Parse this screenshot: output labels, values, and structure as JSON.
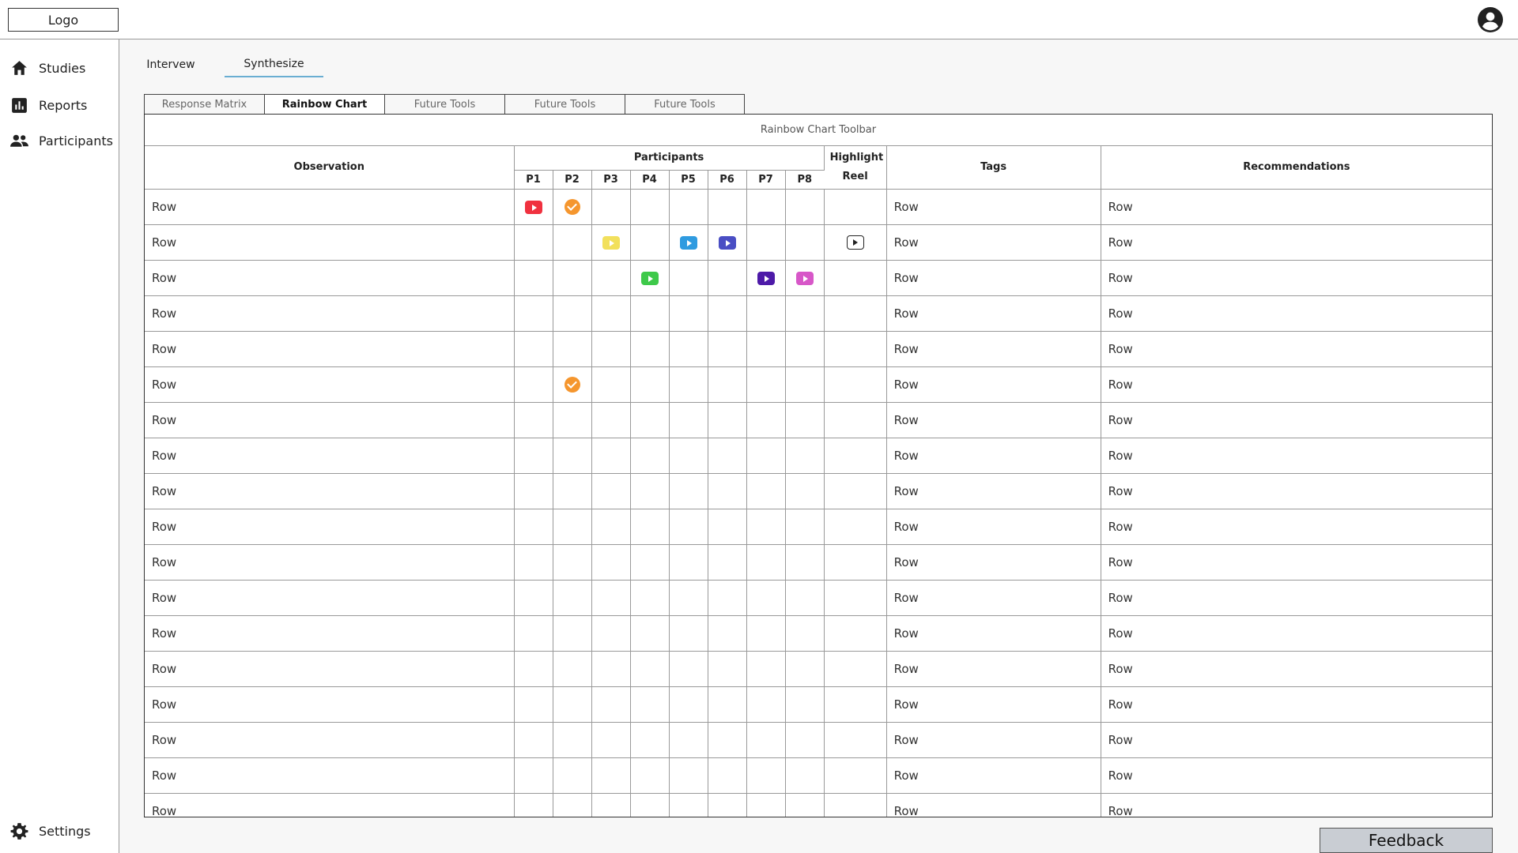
{
  "header": {
    "logo": "Logo",
    "account_icon": "account-circle-icon"
  },
  "sidebar": {
    "items": [
      {
        "label": "Studies",
        "icon": "home-icon"
      },
      {
        "label": "Reports",
        "icon": "bar-chart-icon"
      },
      {
        "label": "Participants",
        "icon": "people-icon"
      }
    ],
    "settings": {
      "label": "Settings",
      "icon": "gear-icon"
    }
  },
  "page_tabs": [
    {
      "label": "Intervew",
      "active": false
    },
    {
      "label": "Synthesize",
      "active": true
    }
  ],
  "tool_tabs": [
    {
      "label": "Response Matrix",
      "active": false
    },
    {
      "label": "Rainbow Chart",
      "active": true
    },
    {
      "label": "Future Tools",
      "active": false
    },
    {
      "label": "Future Tools",
      "active": false
    },
    {
      "label": "Future Tools",
      "active": false
    }
  ],
  "toolbar_label": "Rainbow Chart Toolbar",
  "table": {
    "columns": {
      "observation": "Observation",
      "participants": "Participants",
      "highlight_reel": "Highlight Reel",
      "tags": "Tags",
      "recommendations": "Recommendations"
    },
    "participant_ids": [
      "P1",
      "P2",
      "P3",
      "P4",
      "P5",
      "P6",
      "P7",
      "P8"
    ],
    "colors": {
      "red": "#f0313f",
      "orange": "#f5962e",
      "yellow": "#f2e05c",
      "light_blue": "#2f9be0",
      "indigo": "#4a4ec4",
      "green": "#3ec94a",
      "purple": "#4d1aa8",
      "pink": "#d757c8"
    },
    "rows": [
      {
        "observation": "Row",
        "tags": "Row",
        "recommendations": "Row",
        "highlight_reel": false,
        "marks": [
          {
            "p": 0,
            "kind": "video",
            "color": "red"
          },
          {
            "p": 1,
            "kind": "check",
            "color": "orange"
          }
        ]
      },
      {
        "observation": "Row",
        "tags": "Row",
        "recommendations": "Row",
        "highlight_reel": true,
        "marks": [
          {
            "p": 2,
            "kind": "video",
            "color": "yellow"
          },
          {
            "p": 4,
            "kind": "video",
            "color": "light_blue"
          },
          {
            "p": 5,
            "kind": "video",
            "color": "indigo"
          }
        ]
      },
      {
        "observation": "Row",
        "tags": "Row",
        "recommendations": "Row",
        "highlight_reel": false,
        "marks": [
          {
            "p": 3,
            "kind": "video",
            "color": "green"
          },
          {
            "p": 6,
            "kind": "video",
            "color": "purple"
          },
          {
            "p": 7,
            "kind": "video",
            "color": "pink"
          }
        ]
      },
      {
        "observation": "Row",
        "tags": "Row",
        "recommendations": "Row",
        "highlight_reel": false,
        "marks": []
      },
      {
        "observation": "Row",
        "tags": "Row",
        "recommendations": "Row",
        "highlight_reel": false,
        "marks": []
      },
      {
        "observation": "Row",
        "tags": "Row",
        "recommendations": "Row",
        "highlight_reel": false,
        "marks": [
          {
            "p": 1,
            "kind": "check",
            "color": "orange"
          }
        ]
      },
      {
        "observation": "Row",
        "tags": "Row",
        "recommendations": "Row",
        "highlight_reel": false,
        "marks": []
      },
      {
        "observation": "Row",
        "tags": "Row",
        "recommendations": "Row",
        "highlight_reel": false,
        "marks": []
      },
      {
        "observation": "Row",
        "tags": "Row",
        "recommendations": "Row",
        "highlight_reel": false,
        "marks": []
      },
      {
        "observation": "Row",
        "tags": "Row",
        "recommendations": "Row",
        "highlight_reel": false,
        "marks": []
      },
      {
        "observation": "Row",
        "tags": "Row",
        "recommendations": "Row",
        "highlight_reel": false,
        "marks": []
      },
      {
        "observation": "Row",
        "tags": "Row",
        "recommendations": "Row",
        "highlight_reel": false,
        "marks": []
      },
      {
        "observation": "Row",
        "tags": "Row",
        "recommendations": "Row",
        "highlight_reel": false,
        "marks": []
      },
      {
        "observation": "Row",
        "tags": "Row",
        "recommendations": "Row",
        "highlight_reel": false,
        "marks": []
      },
      {
        "observation": "Row",
        "tags": "Row",
        "recommendations": "Row",
        "highlight_reel": false,
        "marks": []
      },
      {
        "observation": "Row",
        "tags": "Row",
        "recommendations": "Row",
        "highlight_reel": false,
        "marks": []
      },
      {
        "observation": "Row",
        "tags": "Row",
        "recommendations": "Row",
        "highlight_reel": false,
        "marks": []
      },
      {
        "observation": "Row",
        "tags": "Row",
        "recommendations": "Row",
        "highlight_reel": false,
        "marks": []
      }
    ]
  },
  "feedback_label": "Feedback"
}
